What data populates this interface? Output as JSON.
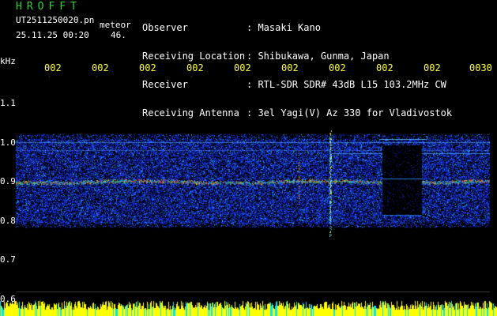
{
  "header": {
    "app_title": "HROFFT",
    "file_name": "UT2511250020.pn",
    "mode_label": "meteor",
    "date_time": "25.11.25 00:20",
    "count": "46."
  },
  "station_info": [
    {
      "label": "Observer",
      "value": ": Masaki Kano"
    },
    {
      "label": "Receiving Location",
      "value": ": Shibukawa, Gunma, Japan"
    },
    {
      "label": "Receiver",
      "value": ": RTL-SDR SDR# 43dB L15 103.2MHz CW"
    },
    {
      "label": "Receiving Antenna",
      "value": ": 3el Yagi(V) Az 330 for Vladivostok"
    }
  ],
  "axis": {
    "unit": "kHz",
    "y_ticks": [
      {
        "label": "1.1",
        "value": 1.1
      },
      {
        "label": "1.0",
        "value": 1.0
      },
      {
        "label": "0.9",
        "value": 0.9
      },
      {
        "label": "0.8",
        "value": 0.8
      },
      {
        "label": "0.7",
        "value": 0.7
      },
      {
        "label": "0.6",
        "value": 0.6
      }
    ],
    "x_ticks": [
      "002",
      "002",
      "002",
      "002",
      "002",
      "002",
      "002",
      "002",
      "002",
      "0030"
    ]
  },
  "colors": {
    "title_green": "#2fd52f",
    "tick_yellow": "#ffff33",
    "signal_red": "#ff3b1a",
    "noise_blue": "#1a3cff",
    "bar_yellow": "#ffff00",
    "bar_cyan": "#00e5ff"
  }
}
